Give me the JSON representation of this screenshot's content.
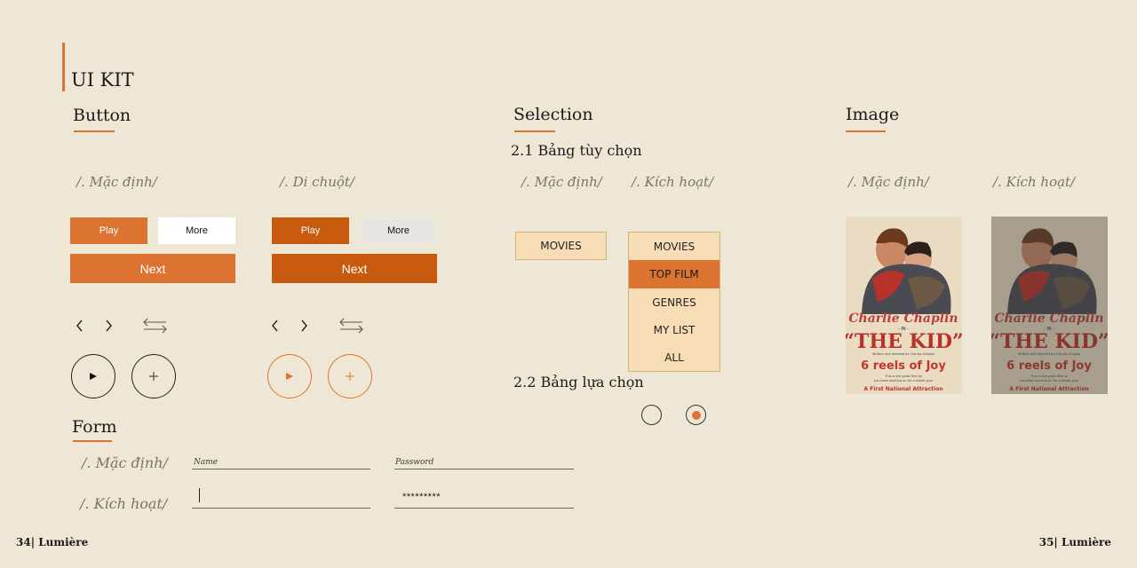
{
  "page_title": "UI KIT",
  "sections": {
    "button": "Button",
    "selection": "Selection",
    "image": "Image",
    "form": "Form"
  },
  "labels": {
    "default": "/. Mặc định/",
    "hover": "/. Di chuột/",
    "active": "/. Kích hoạt/"
  },
  "buttons": {
    "play": "Play",
    "more": "More",
    "next": "Next"
  },
  "selection": {
    "subtitle_options": "2.1 Bảng tùy chọn",
    "subtitle_choice": "2.2 Bảng lựa chọn",
    "default_item": "MOVIES",
    "menu_items": [
      "MOVIES",
      "TOP FILM",
      "GENRES",
      "MY LIST",
      "ALL"
    ],
    "active_index": 1
  },
  "form": {
    "name_label": "Name",
    "password_label": "Password",
    "password_value": "*********"
  },
  "poster": {
    "name": "Charlie Chaplin",
    "in": "IN",
    "title": "“THE KID”",
    "credit": "Written and directed by Charles Chaplin",
    "reels": "6 reels of Joy",
    "tagline": "This is the great film he has been working on for a whole year",
    "footer": "A First National Attraction"
  },
  "footer": {
    "left": "34| Lumière",
    "right": "35| Lumière"
  },
  "colors": {
    "background": "#efe7d6",
    "accent": "#dd7330",
    "accent_hover": "#c85a10",
    "selection_bg": "#f6ddb5"
  }
}
